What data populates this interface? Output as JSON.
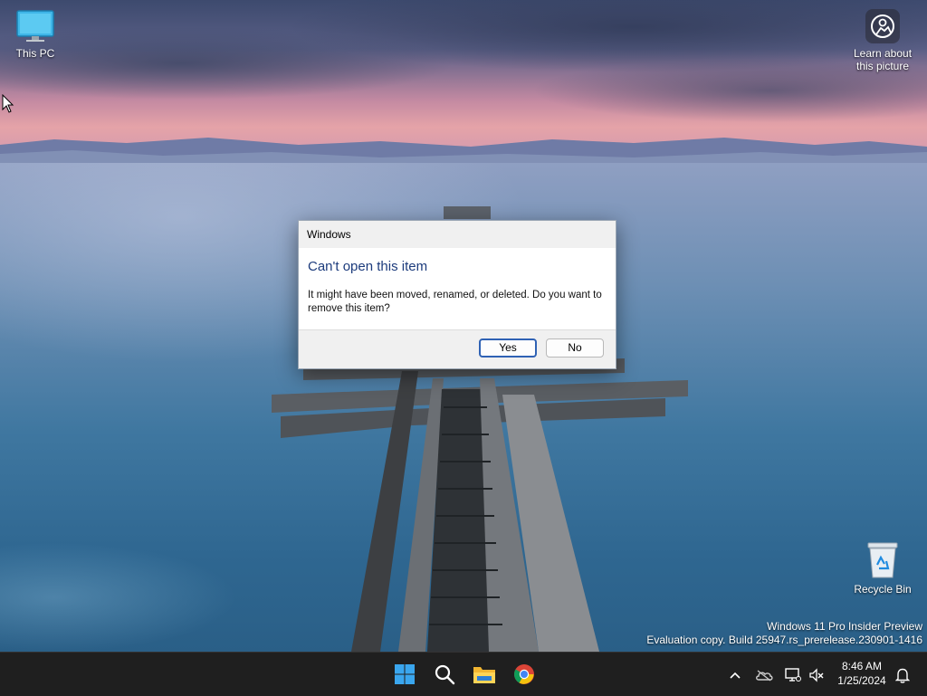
{
  "desktop": {
    "icons": {
      "this_pc": "This PC",
      "recycle_bin": "Recycle Bin",
      "learn_line1": "Learn about",
      "learn_line2": "this picture"
    },
    "watermark": {
      "line1": "Windows 11 Pro Insider Preview",
      "line2": "Evaluation copy. Build 25947.rs_prerelease.230901-1416"
    }
  },
  "dialog": {
    "title": "Windows",
    "heading": "Can't open this item",
    "message": "It might have been moved, renamed, or deleted. Do you want to remove this item?",
    "yes_label": "Yes",
    "no_label": "No"
  },
  "taskbar": {
    "pinned": [
      "start-icon",
      "search-icon",
      "file-explorer-icon",
      "chrome-icon"
    ],
    "tray": [
      "chevron-up-icon",
      "onedrive-icon",
      "network-icon",
      "volume-muted-icon",
      "notification-bell-icon"
    ],
    "time": "8:46 AM",
    "date": "1/25/2024"
  },
  "colors": {
    "dialog_heading": "#1c3b7c",
    "accent": "#2f62b4",
    "taskbar": "#1f1f1f"
  }
}
